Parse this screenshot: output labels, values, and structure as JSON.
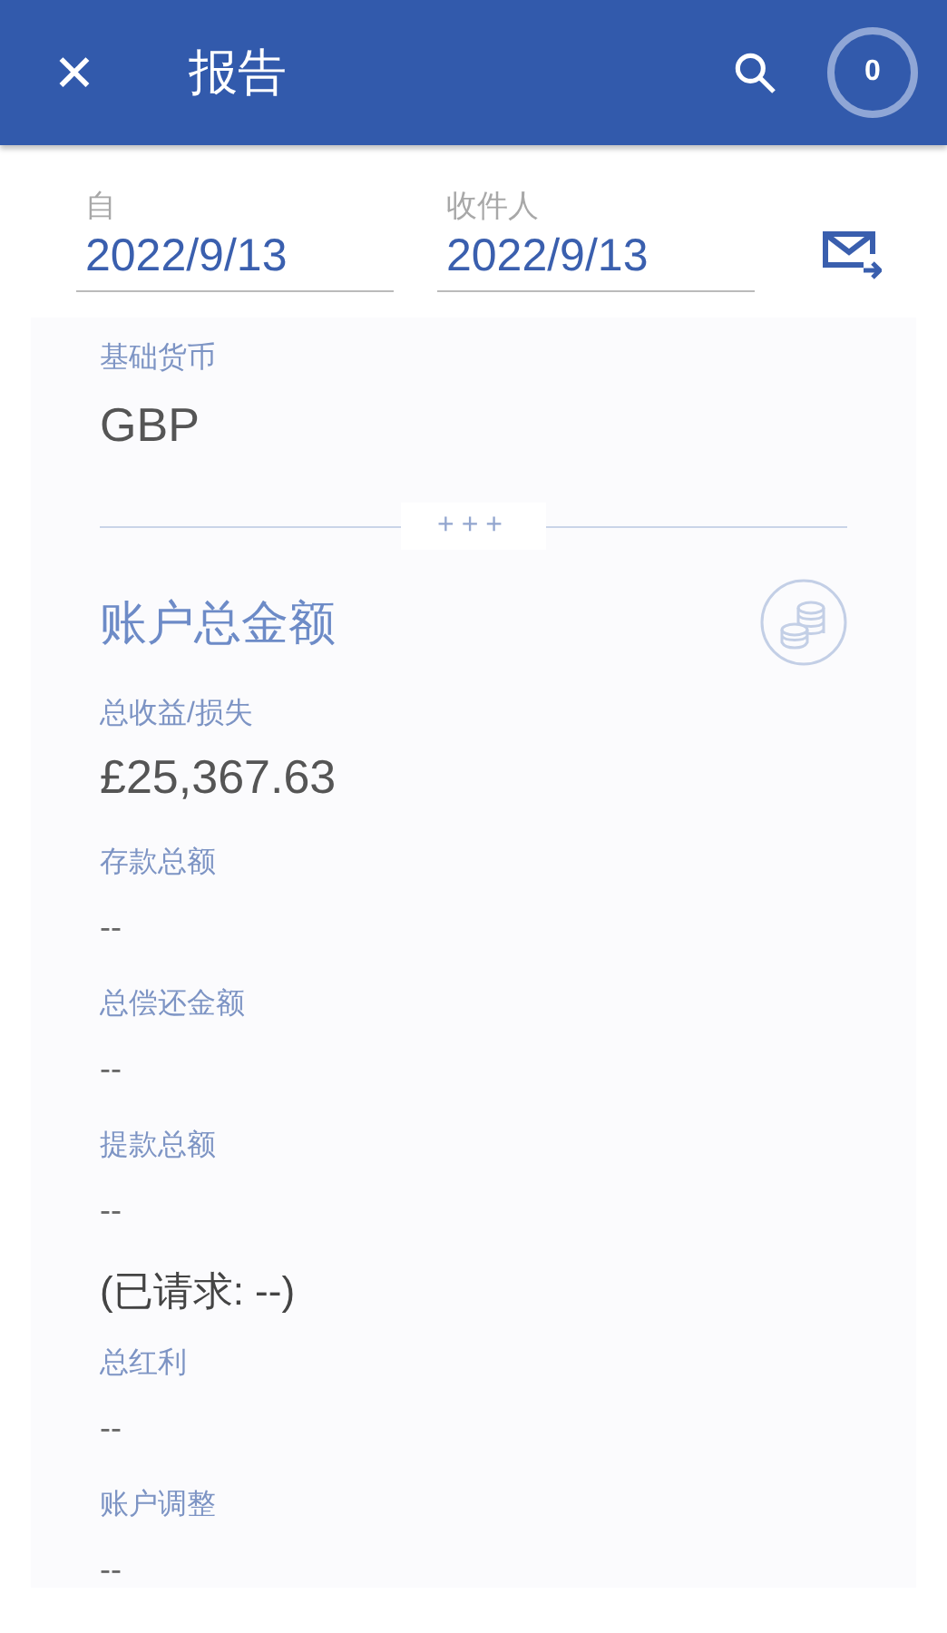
{
  "app_bar": {
    "close": "✕",
    "title": "报告",
    "badge": "0"
  },
  "date_range": [
    {
      "label": "自",
      "value": "2022/9/13"
    },
    {
      "label": "收件人",
      "value": "2022/9/13"
    }
  ],
  "base_currency": {
    "label": "基础货币",
    "value": "GBP"
  },
  "divider": "+++",
  "section": {
    "title": "账户总金额",
    "fields": [
      {
        "kind": "pair",
        "label": "总收益/损失",
        "value": "£25,367.63"
      },
      {
        "kind": "pair",
        "label": "存款总额",
        "value": "--"
      },
      {
        "kind": "pair",
        "label": "总偿还金额",
        "value": "--"
      },
      {
        "kind": "pair",
        "label": "提款总额",
        "value": "--"
      },
      {
        "kind": "note",
        "value": "(已请求: --)"
      },
      {
        "kind": "pair",
        "label": "总红利",
        "value": "--"
      },
      {
        "kind": "pair",
        "label": "账户调整",
        "value": "--"
      }
    ]
  }
}
